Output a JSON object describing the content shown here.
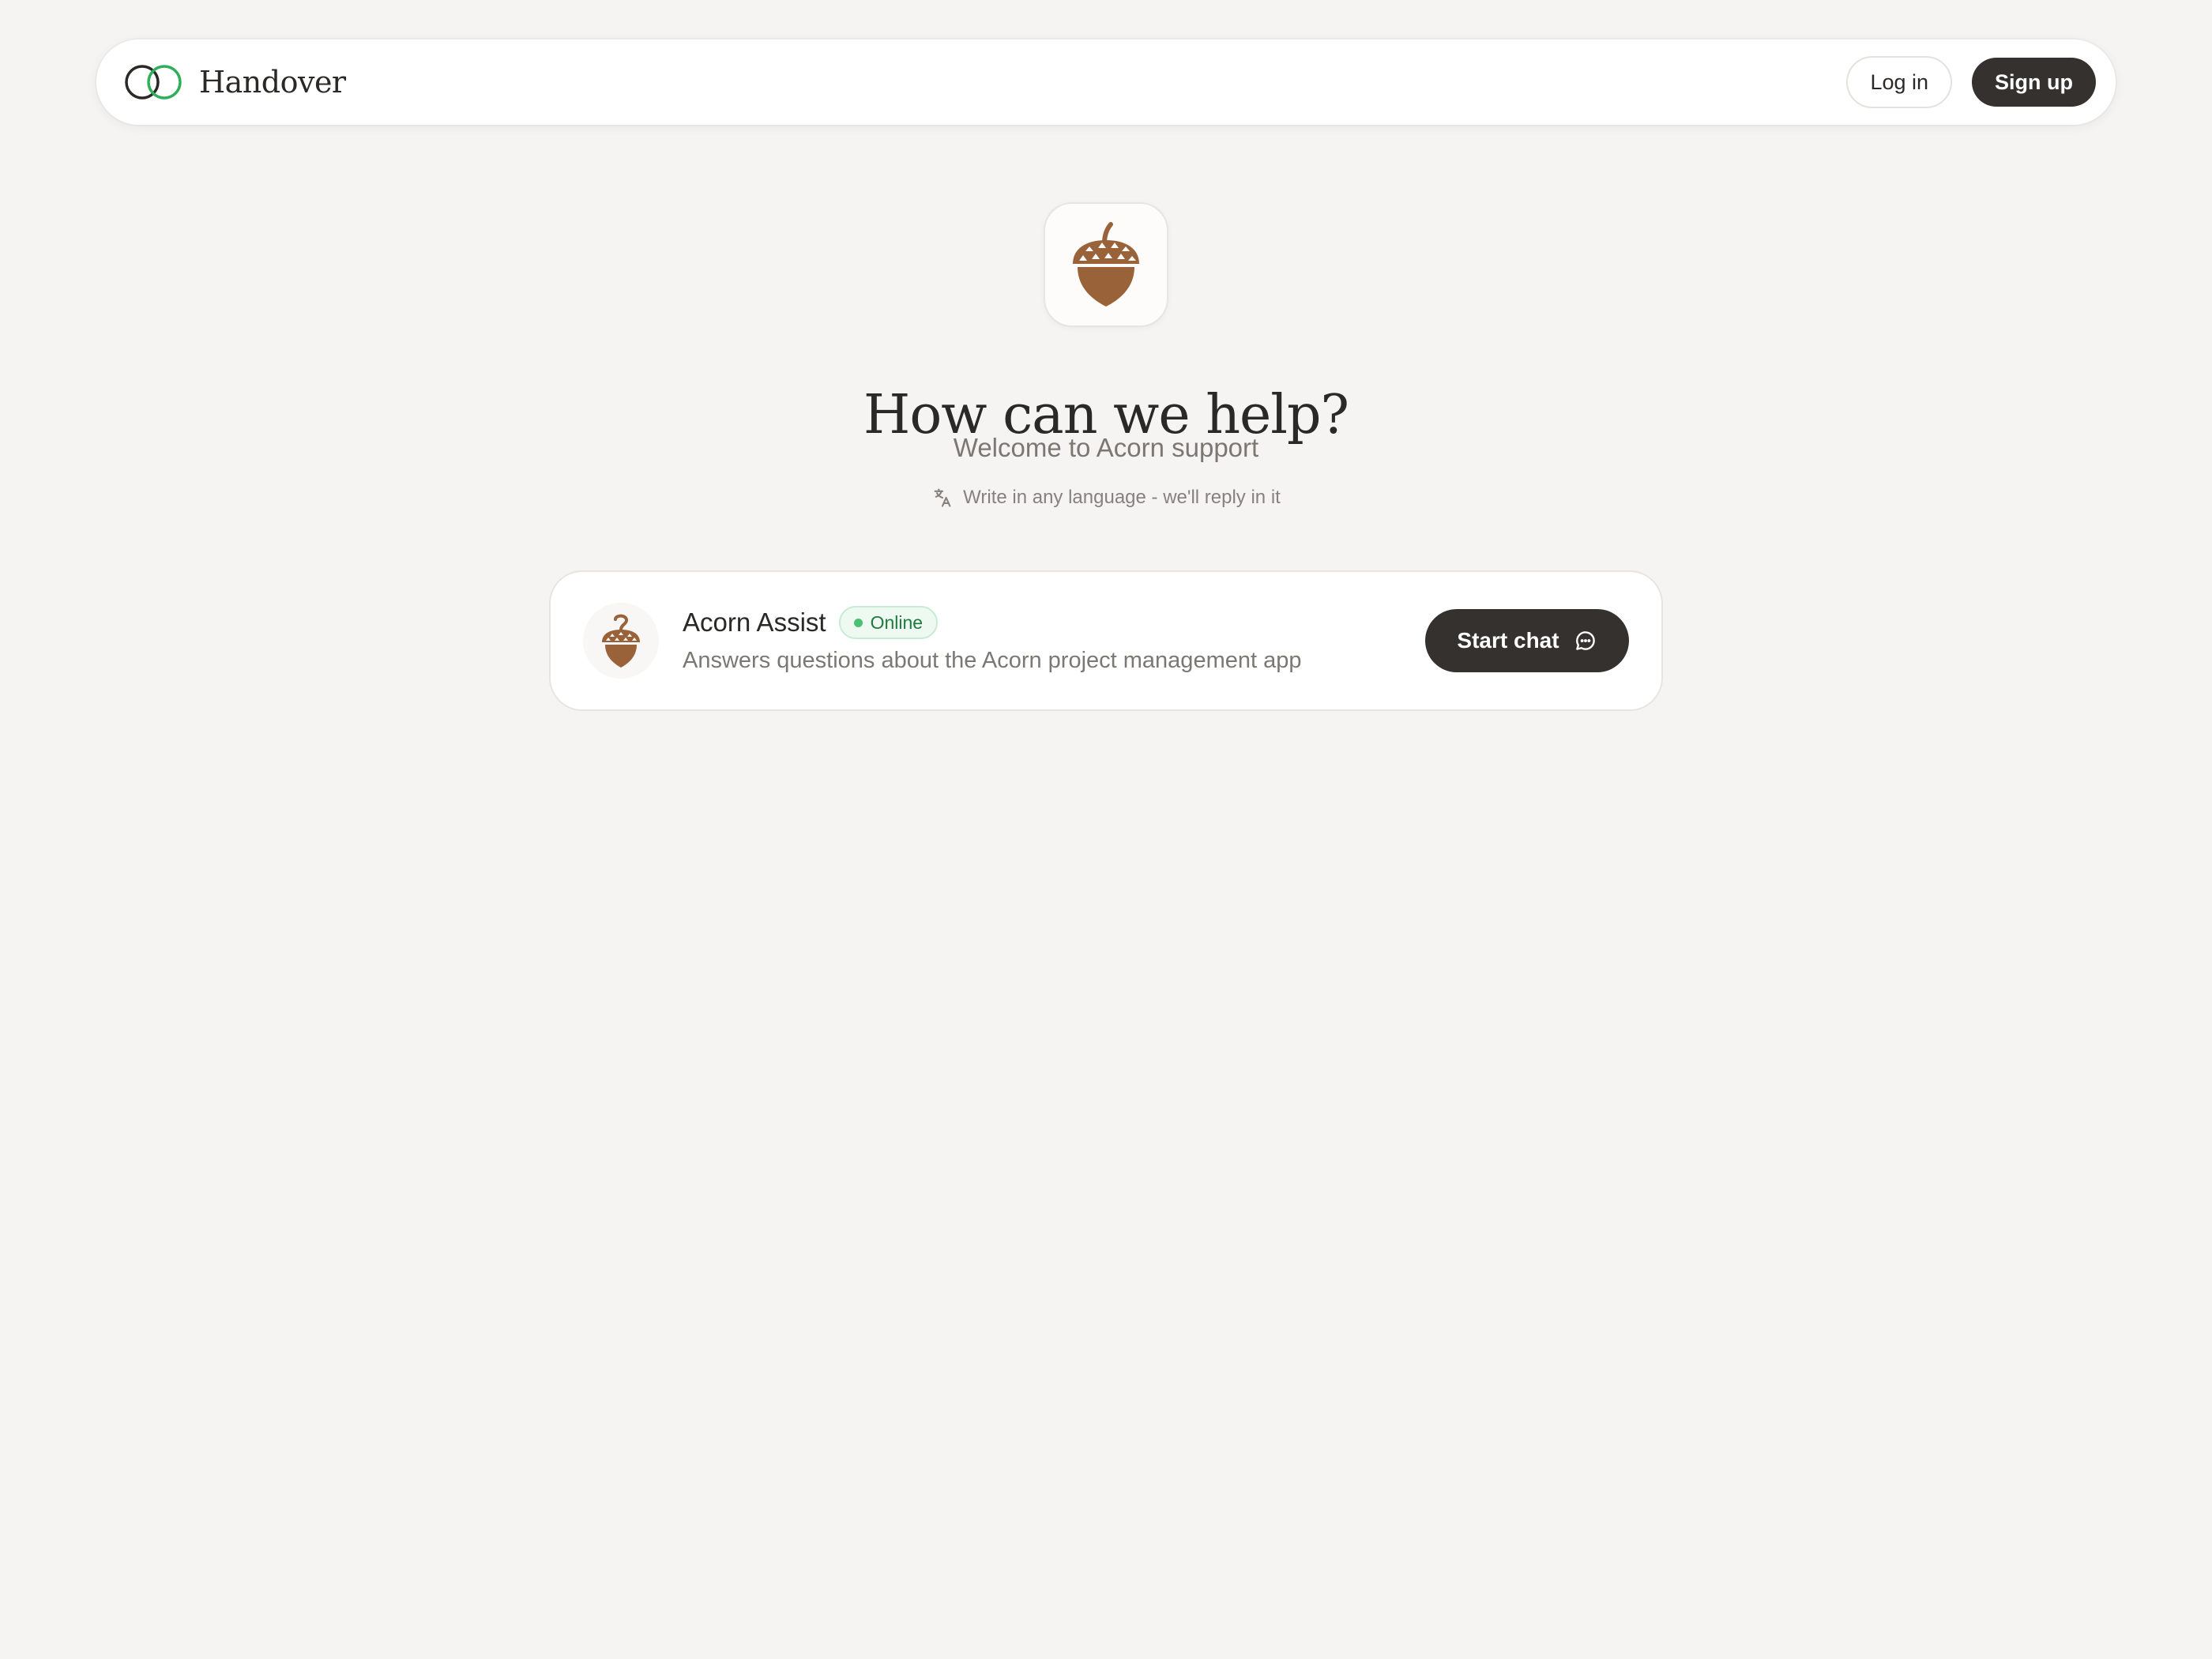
{
  "brand": {
    "name": "Handover",
    "logo_icon": "two-overlapping-rings-icon",
    "logo_colors": {
      "ring_left": "#2b2927",
      "ring_right": "#2fae5b"
    }
  },
  "nav": {
    "login_label": "Log in",
    "signup_label": "Sign up"
  },
  "hero": {
    "icon": "acorn-icon",
    "title": "How can we help?",
    "subtitle": "Welcome to Acorn support",
    "hint_icon": "translate-icon",
    "hint_text": "Write in any language - we'll reply in it"
  },
  "assistant": {
    "avatar_icon": "acorn-question-icon",
    "name": "Acorn Assist",
    "status": "Online",
    "description": "Answers questions about the Acorn project management app",
    "start_chat_label": "Start chat",
    "start_chat_icon": "chat-bubble-icon"
  },
  "colors": {
    "background": "#f5f4f2",
    "acorn_brown": "#9a6238",
    "dark_button": "#34312e",
    "online_green": "#4cc172"
  }
}
